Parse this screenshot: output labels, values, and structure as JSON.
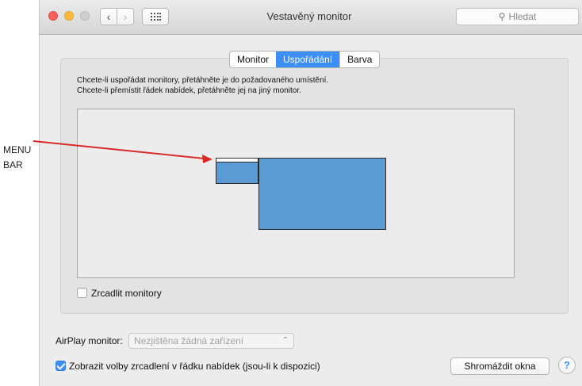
{
  "annotation": {
    "line1": "MENU",
    "line2": "BAR",
    "arrow_color": "#d92a2a"
  },
  "window": {
    "title": "Vestavěný monitor",
    "search_placeholder": "Hledat",
    "nav_back": "‹",
    "nav_forward": "›"
  },
  "tabs": [
    {
      "label": "Monitor",
      "active": false
    },
    {
      "label": "Uspořádání",
      "active": true
    },
    {
      "label": "Barva",
      "active": false
    }
  ],
  "instructions": {
    "line1": "Chcete-li uspořádat monitory, přetáhněte je do požadovaného umístění.",
    "line2": "Chcete-li přemístit řádek nabídek, přetáhněte jej na jiný monitor."
  },
  "mirror": {
    "label": "Zrcadlit monitory",
    "checked": false
  },
  "airplay": {
    "label": "AirPlay monitor:",
    "selected": "Nezjištěna žádná zařízení"
  },
  "show_mirroring": {
    "label": "Zobrazit volby zrcadlení v řádku nabídek (jsou-li k dispozici)",
    "checked": true
  },
  "buttons": {
    "gather_windows": "Shromáždit okna",
    "help": "?"
  },
  "colors": {
    "accent": "#3d8ef8",
    "monitor_fill": "#5a9bd4"
  }
}
